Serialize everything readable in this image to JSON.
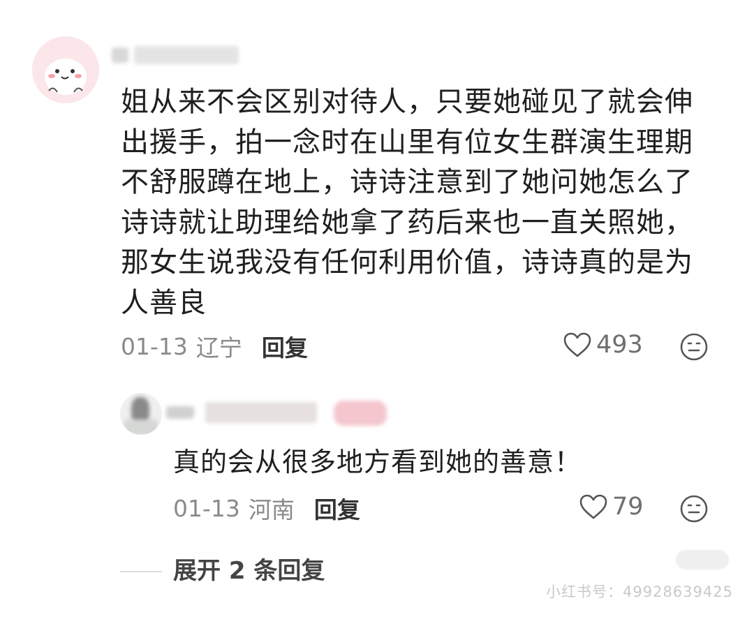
{
  "main_comment": {
    "text": "姐从来不会区别对待人，只要她碰见了就会伸出援手，拍一念时在山里有位女生群演生理期不舒服蹲在地上，诗诗注意到了她问她怎么了诗诗就让助理给她拿了药后来也一直关照她，那女生说我没有任何利用价值，诗诗真的是为人善良",
    "date": "01-13",
    "location": "辽宁",
    "reply_label": "回复",
    "like_count": "493"
  },
  "reply_comment": {
    "text": "真的会从很多地方看到她的善意！",
    "date": "01-13",
    "location": "河南",
    "reply_label": "回复",
    "like_count": "79"
  },
  "expand_replies": {
    "label": "展开 2 条回复"
  },
  "watermark": {
    "text": "小红书号：4992863942​5"
  },
  "icons": {
    "like": "heart-outline-icon",
    "emoji": "emoji-face-icon"
  },
  "colors": {
    "text": "#1f1f1f",
    "meta": "#8a8a8a",
    "avatar_main_bg": "#fbe6ea",
    "avatar_reply_bg": "#eef0ee"
  }
}
